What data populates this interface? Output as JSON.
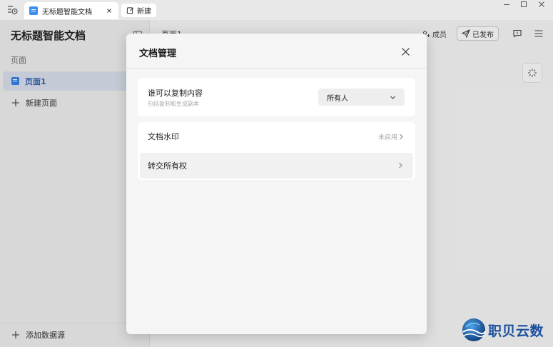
{
  "titlebar": {
    "doc_tab_label": "无标题智能文档",
    "new_tab_label": "新建"
  },
  "sidebar": {
    "doc_title": "无标题智能文档",
    "section_label": "页面",
    "pages": [
      {
        "label": "页面1",
        "selected": true
      }
    ],
    "new_page_label": "新建页面",
    "add_data_source_label": "添加数据源"
  },
  "header": {
    "breadcrumb": "页面1",
    "members_label": "成员",
    "published_label": "已发布"
  },
  "modal": {
    "title": "文档管理",
    "copy_setting": {
      "label": "谁可以复制内容",
      "sub_label": "包括复制和生成副本",
      "selected_value": "所有人"
    },
    "watermark": {
      "label": "文档水印",
      "status": "未启用"
    },
    "transfer_ownership": {
      "label": "转交所有权"
    }
  },
  "brand": {
    "text": "职贝云数"
  },
  "colors": {
    "accent": "#2f7de1",
    "selected_bg": "#d4dbe6",
    "brand_text": "#1d4f9e"
  }
}
